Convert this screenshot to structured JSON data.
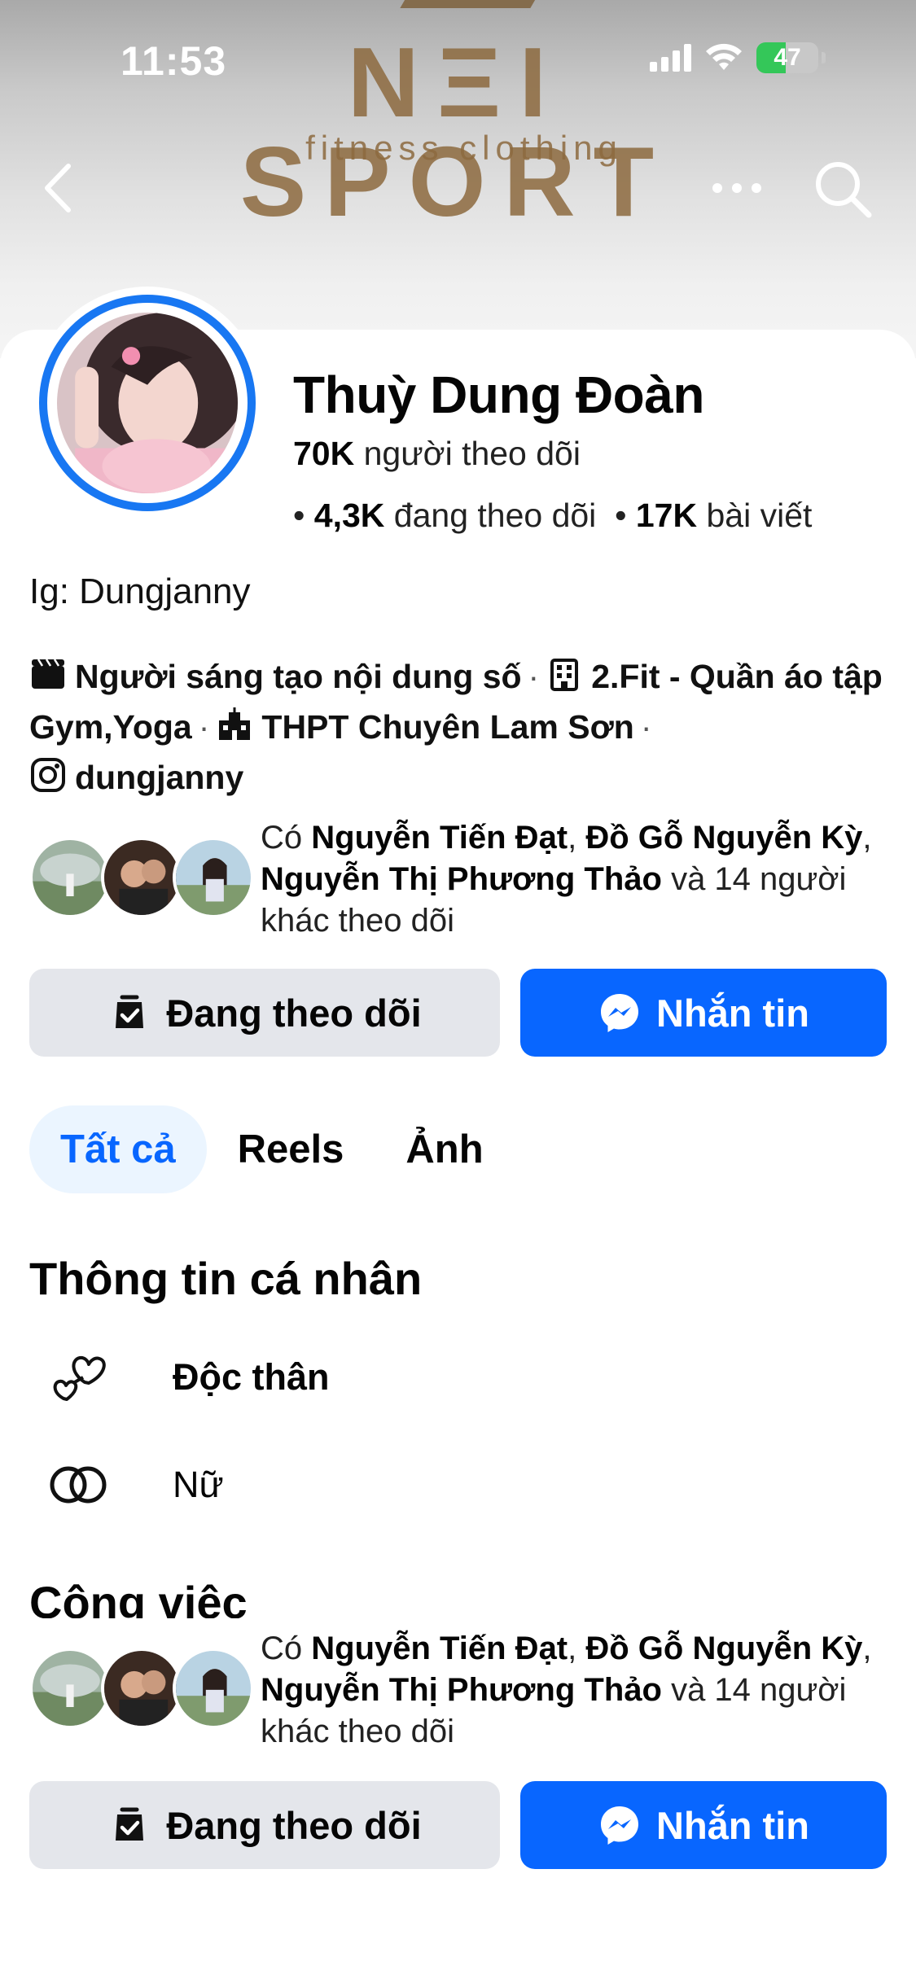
{
  "status_bar": {
    "time": "11:53",
    "battery": "47",
    "battery_level": 0.47
  },
  "cover": {
    "brand_name": "NΞI SPORT",
    "brand_tagline": "fitness clothing"
  },
  "nav": {
    "back_icon": "chevron-left-icon",
    "more_icon": "more-dots-icon",
    "search_icon": "search-icon"
  },
  "profile": {
    "name": "Thuỳ Dung Đoàn",
    "followers_count": "70K",
    "followers_label": "người theo dõi",
    "following_count": "4,3K",
    "following_label": "đang theo dõi",
    "posts_count": "17K",
    "posts_label": "bài viết",
    "bio": "Ig: Dungjanny",
    "details": {
      "creator": "Người sáng tạo nội dung số",
      "work": "2.Fit - Quần áo tập Gym,Yoga",
      "school": "THPT Chuyên Lam Sơn",
      "instagram": "dungjanny"
    }
  },
  "mutual_followers": {
    "prefix": "Có",
    "names": [
      "Nguyễn Tiến Đạt",
      "Đồ Gỗ Nguyễn Kỳ",
      "Nguyễn Thị Phương Thảo"
    ],
    "suffix": "và 14 người khác theo dõi"
  },
  "actions": {
    "follow_label": "Đang theo dõi",
    "message_label": "Nhắn tin"
  },
  "tabs": [
    {
      "label": "Tất cả",
      "active": true
    },
    {
      "label": "Reels",
      "active": false
    },
    {
      "label": "Ảnh",
      "active": false
    }
  ],
  "personal_info": {
    "title": "Thông tin cá nhân",
    "relationship": "Độc thân",
    "gender": "Nữ"
  },
  "work_section": {
    "title": "Công việc"
  },
  "colors": {
    "accent": "#0866ff",
    "avatar_ring": "#1877f2",
    "follow_button_bg": "#e4e6eb",
    "active_tab_bg": "#ebf5ff"
  }
}
